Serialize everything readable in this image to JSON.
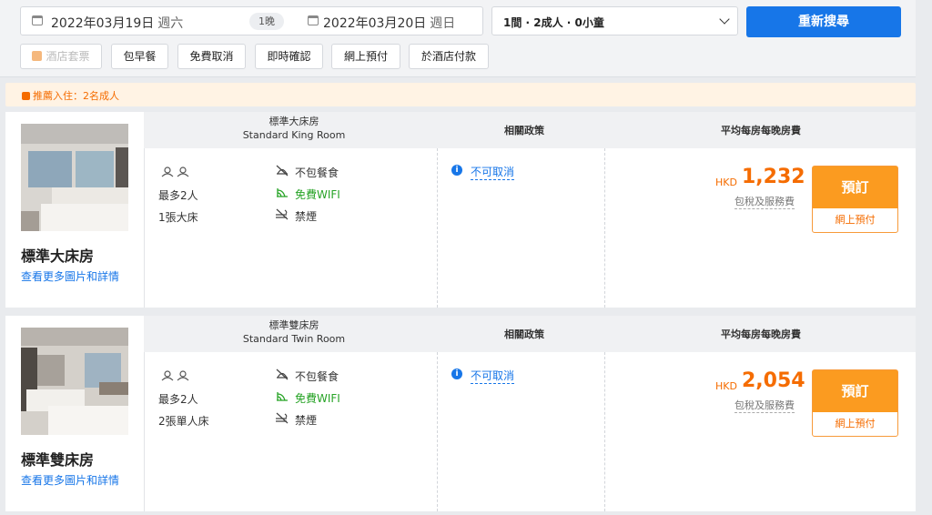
{
  "search": {
    "checkin_date": "2022年03月19日",
    "checkin_dow": "週六",
    "nights": "1晚",
    "checkout_date": "2022年03月20日",
    "checkout_dow": "週日",
    "guests": "1間 · 2成人 · 0小童",
    "search_button": "重新搜尋"
  },
  "filters": [
    "酒店套票",
    "包早餐",
    "免費取消",
    "即時確認",
    "網上預付",
    "於酒店付款"
  ],
  "recommend": "推薦入住：2名成人",
  "columns": {
    "policy": "相關政策",
    "price": "平均每房每晚房費"
  },
  "rooms": [
    {
      "name_zh": "標準大床房",
      "name_en": "Standard King Room",
      "title": "標準大床房",
      "detail_link": "查看更多圖片和詳情",
      "capacity": "最多2人",
      "bed": "1張大床",
      "meal": "不包餐食",
      "wifi": "免費WIFI",
      "smoking": "禁煙",
      "policy": "不可取消",
      "currency": "HKD",
      "price": "1,232",
      "tax_note": "包稅及服務費",
      "book": "預訂",
      "payment": "網上預付"
    },
    {
      "name_zh": "標準雙床房",
      "name_en": "Standard Twin Room",
      "title": "標準雙床房",
      "detail_link": "查看更多圖片和詳情",
      "capacity": "最多2人",
      "bed": "2張單人床",
      "meal": "不包餐食",
      "wifi": "免費WIFI",
      "smoking": "禁煙",
      "policy": "不可取消",
      "currency": "HKD",
      "price": "2,054",
      "tax_note": "包稅及服務費",
      "book": "預訂",
      "payment": "網上預付"
    }
  ],
  "colors": {
    "accent": "#1776e8",
    "orange": "#f56c00",
    "book_button": "#fb9b20",
    "wifi_green": "#26a325"
  }
}
